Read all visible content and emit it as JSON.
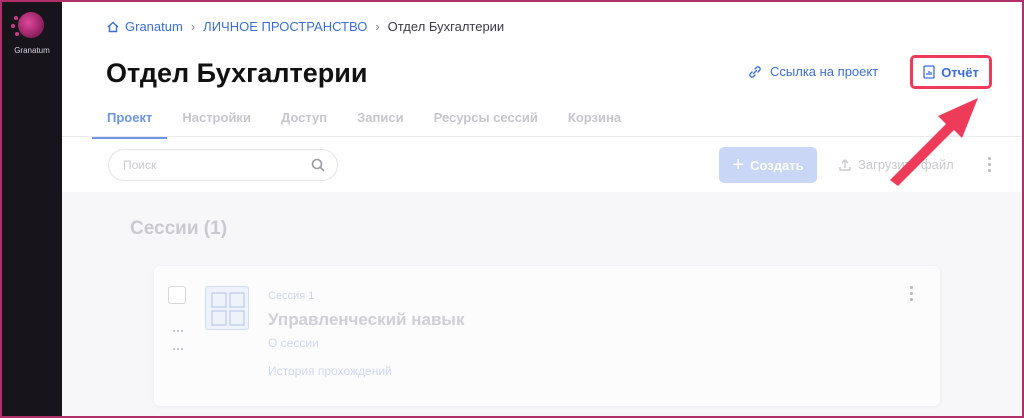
{
  "app": {
    "logo_text": "Granatum"
  },
  "breadcrumb": {
    "items": [
      "Granatum",
      "ЛИЧНОЕ ПРОСТРАНСТВО",
      "Отдел Бухгалтерии"
    ]
  },
  "page": {
    "title": "Отдел Бухгалтерии"
  },
  "actions": {
    "project_link": "Ссылка на проект",
    "report": "Отчёт"
  },
  "tabs": [
    "Проект",
    "Настройки",
    "Доступ",
    "Записи",
    "Ресурсы сессий",
    "Корзина"
  ],
  "toolbar": {
    "search_placeholder": "Поиск",
    "create": "Создать",
    "upload": "Загрузить файл"
  },
  "sessions": {
    "heading": "Сессии (1)",
    "items": [
      {
        "label": "Сессия 1",
        "name": "Управленческий навык",
        "about": "О сессии",
        "history": "История прохождений"
      }
    ]
  },
  "colors": {
    "accent": "#3b6fd6",
    "highlight": "#ee3b5a",
    "sidebar": "#17141c"
  }
}
